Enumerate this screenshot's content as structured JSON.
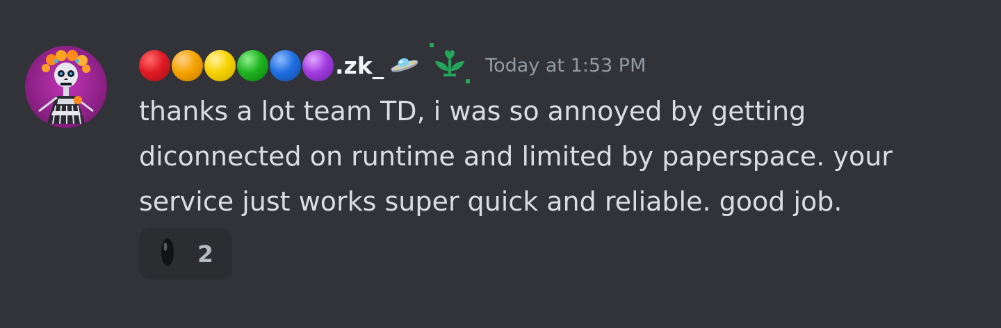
{
  "message": {
    "author": {
      "avatar_icon": "skeleton-catrina-avatar",
      "name_circles": [
        "#e01b24",
        "#f5a300",
        "#f7d200",
        "#1fb41f",
        "#1f6fe0",
        "#a23de0"
      ],
      "username_text": ".zk_",
      "decoration_icons": [
        "ufo-icon",
        "sprout-badge-icon"
      ]
    },
    "timestamp": "Today at 1:53 PM",
    "body": "thanks a lot team TD, i was so annoyed by getting diconnected on runtime and limited by paperspace. your service just works super quick and reliable. good job.",
    "reaction": {
      "icon": "black-seed-emoji",
      "count": "2"
    }
  }
}
